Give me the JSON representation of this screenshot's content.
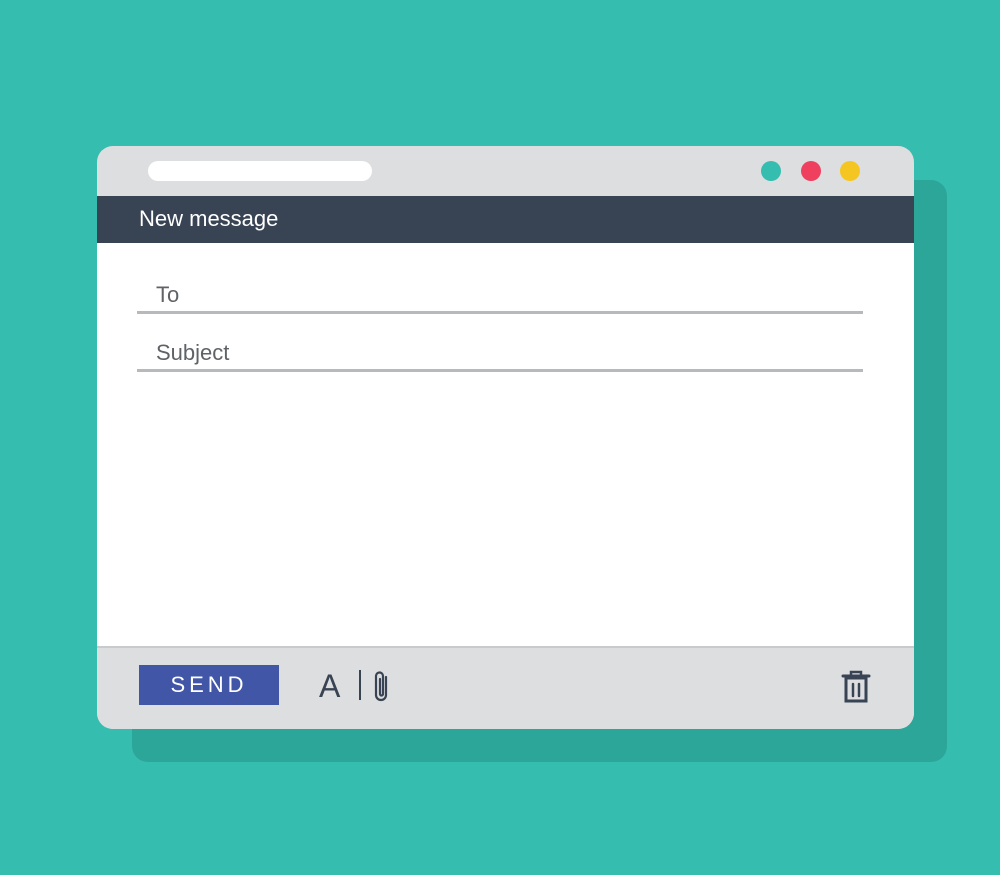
{
  "window": {
    "dots": [
      {
        "name": "teal",
        "color": "#35bdaf"
      },
      {
        "name": "red",
        "color": "#ef4060"
      },
      {
        "name": "yellow",
        "color": "#f5c622"
      }
    ]
  },
  "header": {
    "title": "New message"
  },
  "compose": {
    "to_placeholder": "To",
    "subject_placeholder": "Subject"
  },
  "toolbar": {
    "send_label": "SEND",
    "format_label": "A",
    "attach_icon": "paperclip-icon",
    "trash_icon": "trash-icon"
  },
  "colors": {
    "background": "#35bdaf",
    "title_bar": "#384353",
    "send_button": "#4256a8",
    "window_chrome": "#dddee0"
  }
}
